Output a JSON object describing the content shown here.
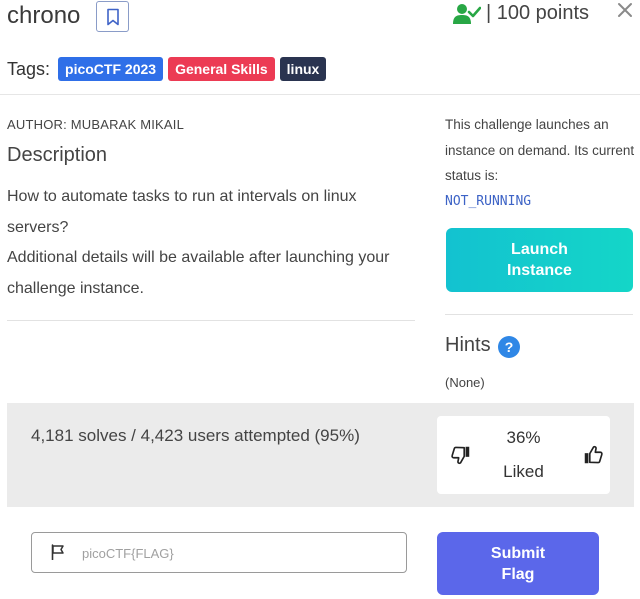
{
  "header": {
    "title": "chrono",
    "points_text": "| 100 points"
  },
  "tags": {
    "label": "Tags:",
    "items": [
      "picoCTF 2023",
      "General Skills",
      "linux"
    ]
  },
  "author": "AUTHOR: MUBARAK MIKAIL",
  "description": {
    "heading": "Description",
    "line1": "How to automate tasks to run at intervals on linux servers?",
    "line2": "Additional details will be available after launching your challenge instance."
  },
  "instance": {
    "text": "This challenge launches an instance on demand. Its current status is:",
    "status": "NOT_RUNNING",
    "launch_label_line1": "Launch",
    "launch_label_line2": "Instance"
  },
  "hints": {
    "heading": "Hints",
    "icon_label": "?",
    "value": "(None)"
  },
  "stats": {
    "solves_text": "4,181 solves / 4,423 users attempted (95%)",
    "liked_percent": "36%",
    "liked_label": "Liked"
  },
  "flag": {
    "placeholder": "picoCTF{FLAG}",
    "submit_line1": "Submit",
    "submit_line2": "Flag"
  },
  "colors": {
    "tag_blue": "#2f6fe8",
    "tag_red": "#ec3b54",
    "tag_dark": "#2a3450",
    "launch_button": "#13c2d0",
    "submit_button": "#5b67ea",
    "status_text": "#3d63c6",
    "solved_icon": "#28a745"
  }
}
